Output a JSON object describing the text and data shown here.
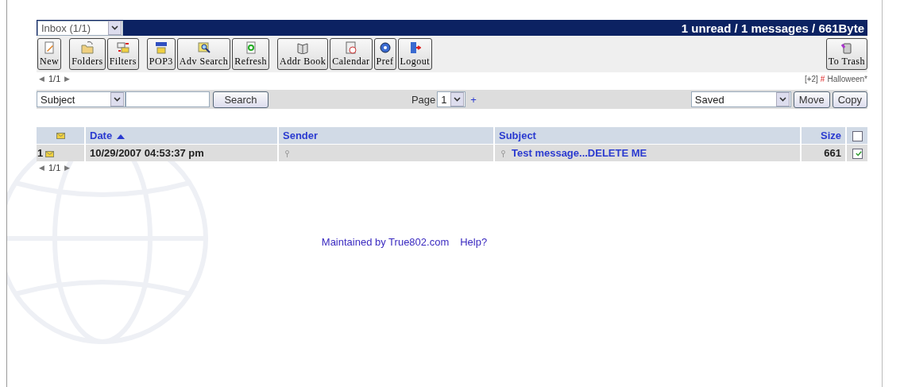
{
  "header": {
    "folder": "Inbox (1/1)",
    "summary": "1 unread / 1 messages / 661Byte"
  },
  "toolbar": {
    "groups": [
      [
        "New"
      ],
      [
        "Folders",
        "Filters"
      ],
      [
        "POP3",
        "Adv Search",
        "Refresh"
      ],
      [
        "Addr Book",
        "Calendar",
        "Pref",
        "Logout"
      ]
    ],
    "trash": "To Trash"
  },
  "pager_top": {
    "prev": "◀",
    "text": "1/1",
    "next": "▶"
  },
  "tags": {
    "count": "[+2]",
    "hash": "#",
    "name": "Halloween*"
  },
  "search": {
    "field": "Subject",
    "button": "Search",
    "page_label": "Page",
    "page": "1",
    "plus": "+",
    "folder": "Saved",
    "move": "Move",
    "copy": "Copy"
  },
  "table": {
    "columns": [
      {
        "label": "Date",
        "sorted": true
      },
      {
        "label": "Sender",
        "sorted": false
      },
      {
        "label": "Subject",
        "sorted": false
      },
      {
        "label": "Size",
        "sorted": false
      }
    ],
    "all_checked": false,
    "rows": [
      {
        "index": "1",
        "unread": true,
        "date": "10/29/2007 04:53:37 pm",
        "subject": "Test message...DELETE ME",
        "size": "661",
        "checked": true
      }
    ]
  },
  "pager_bottom": {
    "prev": "◀",
    "text": "1/1",
    "next": "▶"
  },
  "footer": {
    "credit": "Maintained by True802.com",
    "help": "Help?"
  }
}
